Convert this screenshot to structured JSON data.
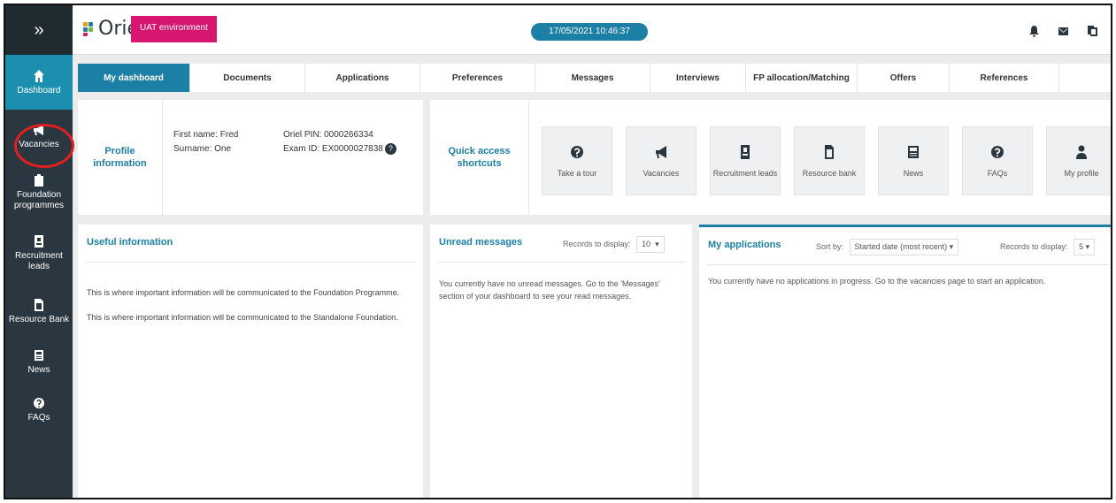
{
  "sidebar": {
    "toggle": "»",
    "items": [
      {
        "label": "Dashboard",
        "icon": "home-icon",
        "active": true
      },
      {
        "label": "Vacancies",
        "icon": "megaphone-icon",
        "active": false
      },
      {
        "label": "Foundation programmes",
        "icon": "clipboard-icon",
        "active": false
      },
      {
        "label": "Recruitment leads",
        "icon": "id-card-icon",
        "active": false
      },
      {
        "label": "Resource Bank",
        "icon": "document-icon",
        "active": false
      },
      {
        "label": "News",
        "icon": "newspaper-icon",
        "active": false
      },
      {
        "label": "FAQs",
        "icon": "question-icon",
        "active": false
      }
    ]
  },
  "header": {
    "logo": "Oriel",
    "environment": "UAT environment",
    "datetime": "17/05/2021 10:46:37",
    "icons": [
      "bell-icon",
      "mail-icon",
      "files-icon"
    ]
  },
  "tabs": [
    "My dashboard",
    "Documents",
    "Applications",
    "Preferences",
    "Messages",
    "Interviews",
    "FP allocation/Matching",
    "Offers",
    "References"
  ],
  "profile": {
    "label": "Profile information",
    "first_name": "First name: Fred",
    "surname": "Surname: One",
    "pin": "Oriel PIN: 0000266334",
    "exam_id": "Exam ID: EX0000027838"
  },
  "quick_access": {
    "label": "Quick access shortcuts",
    "items": [
      {
        "label": "Take a tour",
        "icon": "question-icon"
      },
      {
        "label": "Vacancies",
        "icon": "megaphone-icon"
      },
      {
        "label": "Recruitment leads",
        "icon": "id-card-icon"
      },
      {
        "label": "Resource bank",
        "icon": "document-icon"
      },
      {
        "label": "News",
        "icon": "newspaper-icon"
      },
      {
        "label": "FAQs",
        "icon": "question-icon"
      },
      {
        "label": "My profile",
        "icon": "user-icon"
      }
    ]
  },
  "useful_info": {
    "title": "Useful information",
    "lines": [
      "This is where important information will be communicated to the Foundation Programme.",
      "This is where important information will be communicated to the Standalone Foundation."
    ]
  },
  "unread_messages": {
    "title": "Unread messages",
    "records_label": "Records to display:",
    "records_value": "10",
    "message": "You currently have no unread messages. Go to the 'Messages' section of your dashboard to see your read messages."
  },
  "my_applications": {
    "title": "My applications",
    "sort_label": "Sort by:",
    "sort_value": "Started date (most recent)",
    "records_label": "Records to display:",
    "records_value": "5",
    "message": "You currently have no applications in progress. Go to the vacancies page to start an application."
  },
  "colors": {
    "sidebar": "#2b3740",
    "accent": "#1c7fa6",
    "env_badge": "#d6166f",
    "annotation": "#e02020"
  }
}
